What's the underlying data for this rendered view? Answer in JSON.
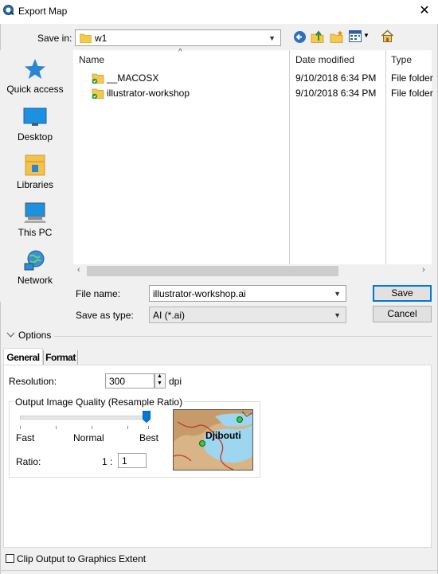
{
  "window": {
    "title": "Export Map"
  },
  "toolbar": {
    "save_in_label": "Save in:",
    "save_in_value": "w1"
  },
  "places": [
    {
      "label": "Quick access",
      "icon": "star-icon"
    },
    {
      "label": "Desktop",
      "icon": "desktop-icon"
    },
    {
      "label": "Libraries",
      "icon": "libraries-icon"
    },
    {
      "label": "This PC",
      "icon": "computer-icon"
    },
    {
      "label": "Network",
      "icon": "network-icon"
    }
  ],
  "filelist": {
    "columns": [
      "Name",
      "Date modified",
      "Type"
    ],
    "rows": [
      {
        "name": "__MACOSX",
        "date": "9/10/2018 6:34 PM",
        "type": "File folder"
      },
      {
        "name": "illustrator-workshop",
        "date": "9/10/2018 6:34 PM",
        "type": "File folder"
      }
    ]
  },
  "form": {
    "file_name_label": "File name:",
    "file_name_value": "illustrator-workshop.ai",
    "save_as_type_label": "Save as type:",
    "save_as_type_value": "AI (*.ai)",
    "save_button": "Save",
    "cancel_button": "Cancel"
  },
  "options": {
    "toggle_label": "Options",
    "tabs": [
      "General",
      "Format"
    ],
    "resolution_label": "Resolution:",
    "resolution_value": "300",
    "resolution_unit": "dpi",
    "quality_group_label": "Output Image Quality (Resample Ratio)",
    "slider_labels": [
      "Fast",
      "Normal",
      "Best"
    ],
    "slider_value": 1.0,
    "ratio_label": "Ratio:",
    "ratio_prefix": "1 :",
    "ratio_value": "1",
    "preview_label": "Djibouti",
    "clip_label": "Clip Output to Graphics Extent"
  }
}
